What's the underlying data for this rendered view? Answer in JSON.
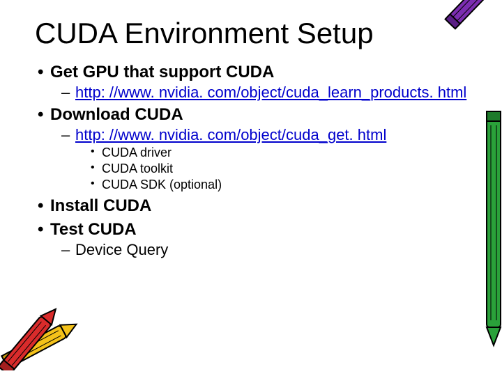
{
  "title": "CUDA Environment Setup",
  "bullets": {
    "b1": "Get GPU that support CUDA",
    "b1_link": "http: //www. nvidia. com/object/cuda_learn_products. html",
    "b2": "Download CUDA",
    "b2_link": "http: //www. nvidia. com/object/cuda_get. html",
    "b2_s1": "CUDA driver",
    "b2_s2": "CUDA toolkit",
    "b2_s3": "CUDA SDK (optional)",
    "b3": "Install CUDA",
    "b4": "Test CUDA",
    "b4_s1": "Device Query"
  },
  "decor": {
    "crayon_purple": "crayon-purple",
    "crayon_green": "crayon-green",
    "crayon_red": "crayon-red",
    "crayon_yellow": "crayon-yellow"
  }
}
